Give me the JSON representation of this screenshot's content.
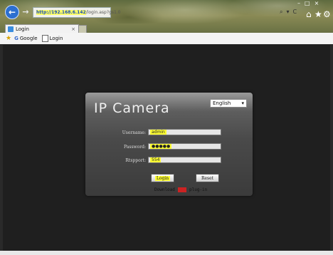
{
  "browser": {
    "url_highlight": "http://192.168.6.142",
    "url_rest": "/login.asp?gs1.0",
    "address_tools": [
      "⌕",
      "▾",
      "C"
    ],
    "tab_title": "Login",
    "tab_close": "×",
    "favorites": [
      {
        "label": "Google",
        "icon": "google-icon"
      },
      {
        "label": "Login",
        "icon": "page-icon"
      }
    ],
    "window_buttons": [
      "–",
      "□",
      "×"
    ]
  },
  "login": {
    "title": "IP Camera",
    "language": "English",
    "username_label": "Username:",
    "username_value": "admin",
    "password_label": "Password:",
    "password_value": "●●●●●",
    "rtsp_label": "Rtspport:",
    "rtsp_value": "554",
    "login_button": "Login",
    "reset_button": "Reset",
    "plugin_text_pre": "Download",
    "plugin_text_hl": "the",
    "plugin_text_post": "plug-in"
  },
  "colors": {
    "highlight": "#ffff33",
    "back_button": "#2c6fd0"
  }
}
